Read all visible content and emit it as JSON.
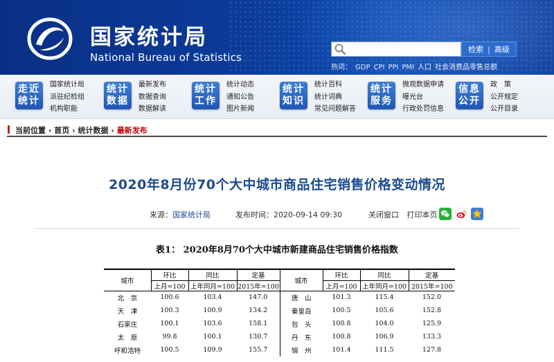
{
  "header": {
    "title_cn": "国家统计局",
    "title_en": "National Bureau of Statistics",
    "search_button": "检索",
    "advanced_button": "高级",
    "hot_label": "热词：",
    "hot_words": [
      "GDP",
      "CPI",
      "PPI",
      "PMI",
      "人口",
      "社会消费品零售总额"
    ]
  },
  "nav": [
    {
      "badge": "走近统计",
      "links": [
        "国家统计局",
        "派驻纪检组",
        "机构职能"
      ]
    },
    {
      "badge": "统计数据",
      "links": [
        "最新发布",
        "数据查询",
        "数据解读"
      ]
    },
    {
      "badge": "统计工作",
      "links": [
        "统计动态",
        "通知公告",
        "图片新闻"
      ]
    },
    {
      "badge": "统计知识",
      "links": [
        "统计百科",
        "统计词典",
        "常见问题解答"
      ]
    },
    {
      "badge": "统计服务",
      "links": [
        "微观数据申请",
        "曝光台",
        "行政处罚信息"
      ]
    },
    {
      "badge": "信息公开",
      "links": [
        "政　策",
        "公开规定",
        "公开目录"
      ]
    }
  ],
  "breadcrumb": {
    "label": "当前位置",
    "items": [
      "首页",
      "统计数据"
    ],
    "current": "最新发布",
    "sep": "›"
  },
  "article": {
    "title": "2020年8月份70个大中城市商品住宅销售价格变动情况",
    "source_label": "来源：",
    "source": "国家统计局",
    "time_label": "发布时间：",
    "time": "2020-09-14 09:30",
    "close_window": "关闭窗口",
    "print_page": "打印本页",
    "share": {
      "wechat": "wechat-icon",
      "weibo": "weibo-icon",
      "star": "star-icon",
      "colors": {
        "wechat": "#2aae3a",
        "weibo": "#e6162d",
        "star": "#f5a623"
      }
    }
  },
  "table": {
    "caption": "表1：  2020年8月70个大中城市新建商品住宅销售价格指数",
    "col_city": "城市",
    "col_mom": "环比",
    "col_yoy": "同比",
    "col_base": "定基",
    "sub_mom": "上月=100",
    "sub_yoy": "上年同月=100",
    "sub_base": "2015年=100",
    "rows": [
      {
        "c1": "北　京",
        "a1": "100.6",
        "b1": "103.4",
        "d1": "147.0",
        "c2": "唐　山",
        "a2": "101.3",
        "b2": "115.4",
        "d2": "152.0"
      },
      {
        "c1": "天　津",
        "a1": "100.3",
        "b1": "100.9",
        "d1": "134.2",
        "c2": "秦皇岛",
        "a2": "100.5",
        "b2": "105.6",
        "d2": "152.8"
      },
      {
        "c1": "石家庄",
        "a1": "100.1",
        "b1": "103.6",
        "d1": "158.1",
        "c2": "包　头",
        "a2": "100.8",
        "b2": "104.0",
        "d2": "125.9"
      },
      {
        "c1": "太　原",
        "a1": "99.8",
        "b1": "100.1",
        "d1": "130.7",
        "c2": "丹　东",
        "a2": "100.8",
        "b2": "106.9",
        "d2": "133.3"
      },
      {
        "c1": "呼和浩特",
        "a1": "100.5",
        "b1": "109.9",
        "d1": "155.7",
        "c2": "锦　州",
        "a2": "101.4",
        "b2": "111.5",
        "d2": "127.8"
      }
    ]
  },
  "colors": {
    "header_bg": "#0b3c9a",
    "title_blue": "#1d4b8f",
    "current_red": "#c00000",
    "badge_blue": "#2c64c0"
  }
}
